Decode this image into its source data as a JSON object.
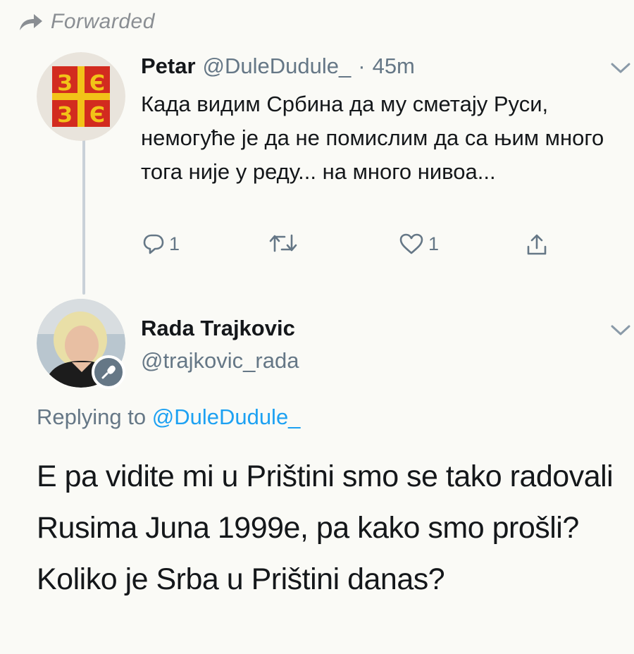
{
  "forwarded": {
    "label": "Forwarded",
    "icon": "forward-arrow-icon"
  },
  "original_tweet": {
    "author_name": "Petar",
    "handle": "@DuleDudule_",
    "separator": "·",
    "time": "45m",
    "text": "Када видим Србина да му сметају Руси, немогуће је да не помислим да са њим много тога није у реду... на много нивоа...",
    "avatar": "serbian-cross-avatar",
    "actions": {
      "reply_count": "1",
      "retweet_count": "",
      "like_count": "1",
      "icons": [
        "reply-icon",
        "retweet-icon",
        "like-icon",
        "share-icon"
      ]
    }
  },
  "reply_tweet": {
    "author_name": "Rada Trajkovic",
    "handle": "@trajkovic_rada",
    "avatar": "user-photo-avatar",
    "badge_icon": "microphone-icon",
    "replying_prefix": "Replying to",
    "replying_to": "@DuleDudule_",
    "text": "E pa vidite mi u Prištini smo se tako radovali Rusima Juna 1999e, pa kako smo prošli? Koliko je Srba u Prištini danas?"
  },
  "colors": {
    "background": "#fafaf6",
    "text_primary": "#14171a",
    "text_muted": "#657786",
    "link": "#1da1f2",
    "thread_line": "#c9d1d8",
    "flag_red": "#d22b1f",
    "flag_gold": "#f2c318"
  }
}
